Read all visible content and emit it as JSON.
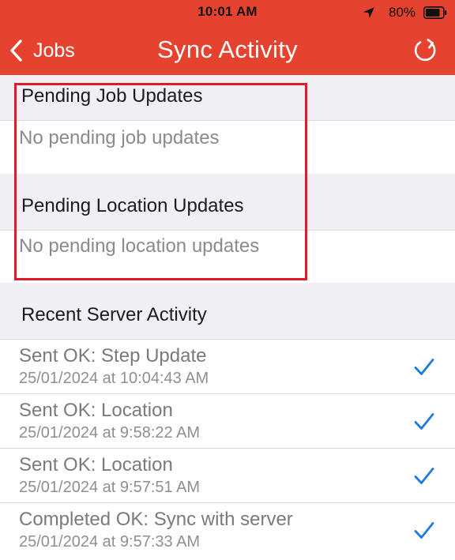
{
  "status_bar": {
    "time": "10:01 AM",
    "battery_percent": "80%"
  },
  "nav": {
    "back_label": "Jobs",
    "title": "Sync Activity"
  },
  "sections": {
    "pending_job": {
      "header": "Pending Job Updates",
      "empty": "No pending job updates"
    },
    "pending_location": {
      "header": "Pending Location Updates",
      "empty": "No pending location updates"
    },
    "recent": {
      "header": "Recent Server Activity"
    }
  },
  "activity": [
    {
      "title": "Sent OK: Step Update",
      "time": "25/01/2024 at 10:04:43 AM",
      "status_icon": "checkmark-icon"
    },
    {
      "title": "Sent OK: Location",
      "time": "25/01/2024 at 9:58:22 AM",
      "status_icon": "checkmark-icon"
    },
    {
      "title": "Sent OK: Location",
      "time": "25/01/2024 at 9:57:51 AM",
      "status_icon": "checkmark-icon"
    },
    {
      "title": "Completed OK: Sync with server",
      "time": "25/01/2024 at 9:57:33 AM",
      "status_icon": "checkmark-icon"
    }
  ],
  "colors": {
    "nav_background": "#e5432f",
    "checkmark": "#1f7ae0",
    "highlight": "#e11a2b",
    "section_background": "#efeff4"
  }
}
